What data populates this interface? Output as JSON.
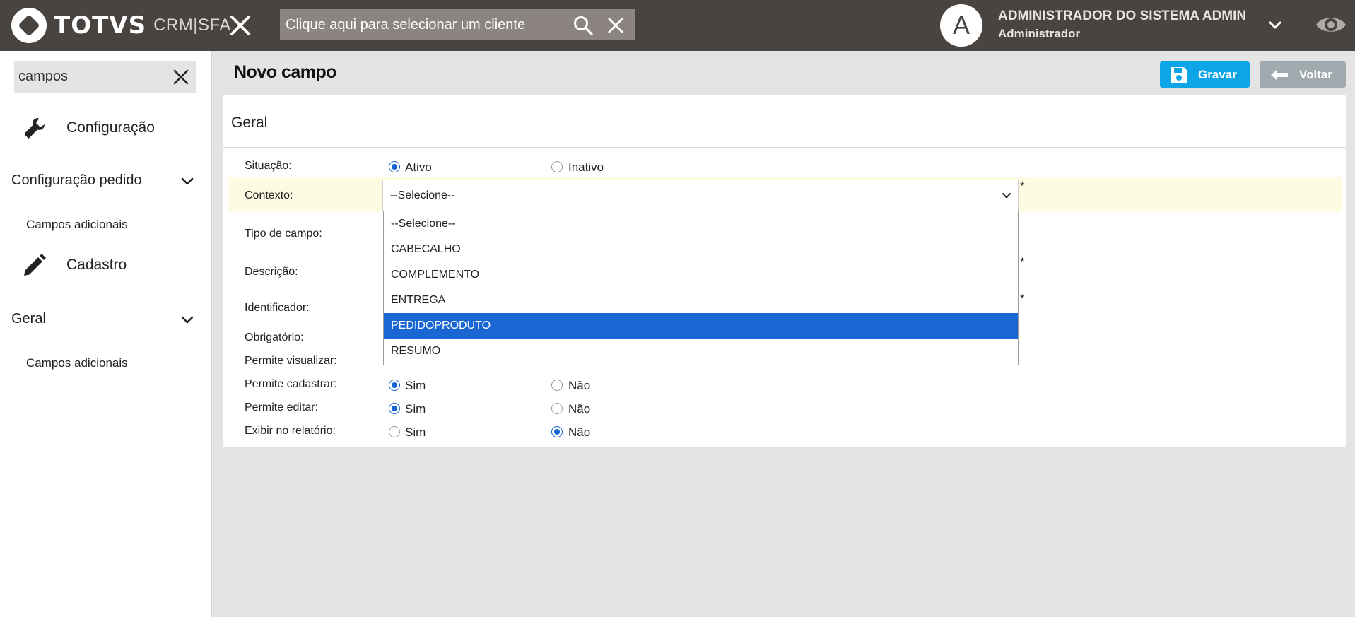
{
  "topbar": {
    "brand": "TOTVS",
    "product": "CRM|SFA",
    "client_search_placeholder": "Clique aqui para selecionar um cliente",
    "user_initial": "A",
    "user_name": "ADMINISTRADOR DO SISTEMA ADMIN",
    "user_role": "Administrador"
  },
  "sidebar": {
    "search_value": "campos",
    "sections": [
      {
        "label": "Configuração",
        "icon": "wrench-icon"
      },
      {
        "label": "Configuração pedido",
        "sub": "Campos adicionais"
      },
      {
        "label": "Cadastro",
        "icon": "pencil-icon"
      },
      {
        "label": "Geral",
        "sub": "Campos adicionais"
      }
    ]
  },
  "page": {
    "title": "Novo campo",
    "save_label": "Gravar",
    "back_label": "Voltar",
    "card_title": "Geral"
  },
  "form": {
    "situacao": {
      "label": "Situação:",
      "options": [
        "Ativo",
        "Inativo"
      ],
      "selected": "Ativo"
    },
    "contexto": {
      "label": "Contexto:",
      "value": "--Selecione--",
      "required": "*"
    },
    "tipo": {
      "label": "Tipo de campo:"
    },
    "descricao": {
      "label": "Descrição:",
      "required": "*"
    },
    "identificador": {
      "label": "Identificador:",
      "required": "*"
    },
    "obrigatorio": {
      "label": "Obrigatório:"
    },
    "visualizar": {
      "label": "Permite visualizar:"
    },
    "cadastrar": {
      "label": "Permite cadastrar:",
      "yes": "Sim",
      "no": "Não",
      "selected": "Sim"
    },
    "editar": {
      "label": "Permite editar:",
      "yes": "Sim",
      "no": "Não",
      "selected": "Sim"
    },
    "relatorio": {
      "label": "Exibir no relatório:",
      "yes": "Sim",
      "no": "Não",
      "selected": "Não"
    }
  },
  "dropdown": {
    "options": [
      "--Selecione--",
      "CABECALHO",
      "COMPLEMENTO",
      "ENTREGA",
      "PEDIDOPRODUTO",
      "RESUMO"
    ],
    "highlighted": "PEDIDOPRODUTO"
  },
  "colors": {
    "topbar": "#4a4441",
    "accent_save": "#0ea5e6",
    "back_button": "#9fa9ae",
    "highlight": "#1a66d2",
    "context_row": "#fdfbe1"
  }
}
